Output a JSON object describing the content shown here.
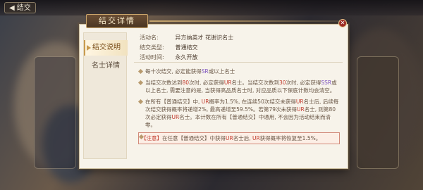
{
  "background": {
    "back_button_label": "结交"
  },
  "modal": {
    "title": "结交详情",
    "close_icon": "close-icon"
  },
  "tabs": [
    {
      "label": "结交说明",
      "active": true
    },
    {
      "label": "名士详情",
      "active": false
    }
  ],
  "info": {
    "activity": {
      "label": "活动名:",
      "value": "异方纳英才 花谢识名士"
    },
    "type": {
      "label": "结交类型:",
      "value": "普通结交"
    },
    "time": {
      "label": "活动时间:",
      "value": "永久开放"
    }
  },
  "rules": [
    {
      "parts": [
        {
          "t": "每十次结交, 必定能获得"
        },
        {
          "t": "SR",
          "c": "purple"
        },
        {
          "t": "或以上名士"
        }
      ]
    },
    {
      "parts": [
        {
          "t": "当结交次数达到"
        },
        {
          "t": "80",
          "c": "red"
        },
        {
          "t": "次时, 必定获得"
        },
        {
          "t": "UR",
          "c": "red"
        },
        {
          "t": "名士。当结交次数到"
        },
        {
          "t": "30",
          "c": "red"
        },
        {
          "t": "次时, 必定获得"
        },
        {
          "t": "SSR",
          "c": "purple"
        },
        {
          "t": "或以上名士, 需要注意的是, 当获得高品质名士时, 对应品质以下保底计数均会清空。"
        }
      ]
    },
    {
      "parts": [
        {
          "t": "在所有【普通结交】中, "
        },
        {
          "t": "UR",
          "c": "red"
        },
        {
          "t": "概率为1.5%, 在连续50次结交未获得"
        },
        {
          "t": "UR",
          "c": "red"
        },
        {
          "t": "名士后, 后续每次结交获得概率将递增2%, 最高递增至59.5%。若第79次未获得"
        },
        {
          "t": "UR",
          "c": "red"
        },
        {
          "t": "名士, 则第80次必定获得"
        },
        {
          "t": "UR",
          "c": "red"
        },
        {
          "t": "名士。本计数在所有【普通结交】中通用, 不会因为活动结束而清零。"
        }
      ]
    },
    {
      "notice": true,
      "parts": [
        {
          "t": "【注意】",
          "c": "red"
        },
        {
          "t": "在任意【普通结交】中获得"
        },
        {
          "t": "UR",
          "c": "red"
        },
        {
          "t": "名士后, "
        },
        {
          "t": "UR",
          "c": "red"
        },
        {
          "t": "获得概率将恢复至1.5%。"
        }
      ]
    }
  ]
}
